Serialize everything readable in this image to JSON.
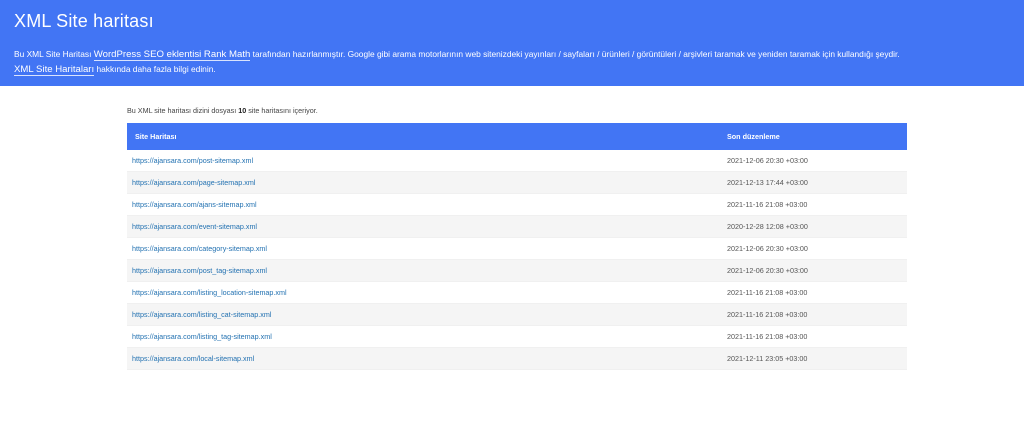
{
  "header": {
    "title": "XML Site haritası",
    "desc_part1": "Bu XML Site Haritası ",
    "desc_link1": "WordPress SEO eklentisi Rank Math",
    "desc_part2": " tarafından hazırlanmıştır. Google gibi arama motorlarının web sitenizdeki yayınları / sayfaları / ürünleri / görüntüleri / arşivleri taramak ve yeniden taramak için kullandığı şeydir.",
    "desc_link2": "XML Site Haritaları",
    "desc_part3": " hakkında daha fazla bilgi edinin."
  },
  "summary": {
    "prefix": "Bu XML site haritası dizini dosyası ",
    "count": "10",
    "suffix": " site haritasını içeriyor."
  },
  "table": {
    "col_sitemap": "Site Haritası",
    "col_modified": "Son düzenleme",
    "rows": [
      {
        "url": "https://ajansara.com/post-sitemap.xml",
        "modified": "2021-12-06 20:30 +03:00"
      },
      {
        "url": "https://ajansara.com/page-sitemap.xml",
        "modified": "2021-12-13 17:44 +03:00"
      },
      {
        "url": "https://ajansara.com/ajans-sitemap.xml",
        "modified": "2021-11-16 21:08 +03:00"
      },
      {
        "url": "https://ajansara.com/event-sitemap.xml",
        "modified": "2020-12-28 12:08 +03:00"
      },
      {
        "url": "https://ajansara.com/category-sitemap.xml",
        "modified": "2021-12-06 20:30 +03:00"
      },
      {
        "url": "https://ajansara.com/post_tag-sitemap.xml",
        "modified": "2021-12-06 20:30 +03:00"
      },
      {
        "url": "https://ajansara.com/listing_location-sitemap.xml",
        "modified": "2021-11-16 21:08 +03:00"
      },
      {
        "url": "https://ajansara.com/listing_cat-sitemap.xml",
        "modified": "2021-11-16 21:08 +03:00"
      },
      {
        "url": "https://ajansara.com/listing_tag-sitemap.xml",
        "modified": "2021-11-16 21:08 +03:00"
      },
      {
        "url": "https://ajansara.com/local-sitemap.xml",
        "modified": "2021-12-11 23:05 +03:00"
      }
    ]
  },
  "colors": {
    "accent": "#4275f4",
    "link": "#2271b1"
  }
}
